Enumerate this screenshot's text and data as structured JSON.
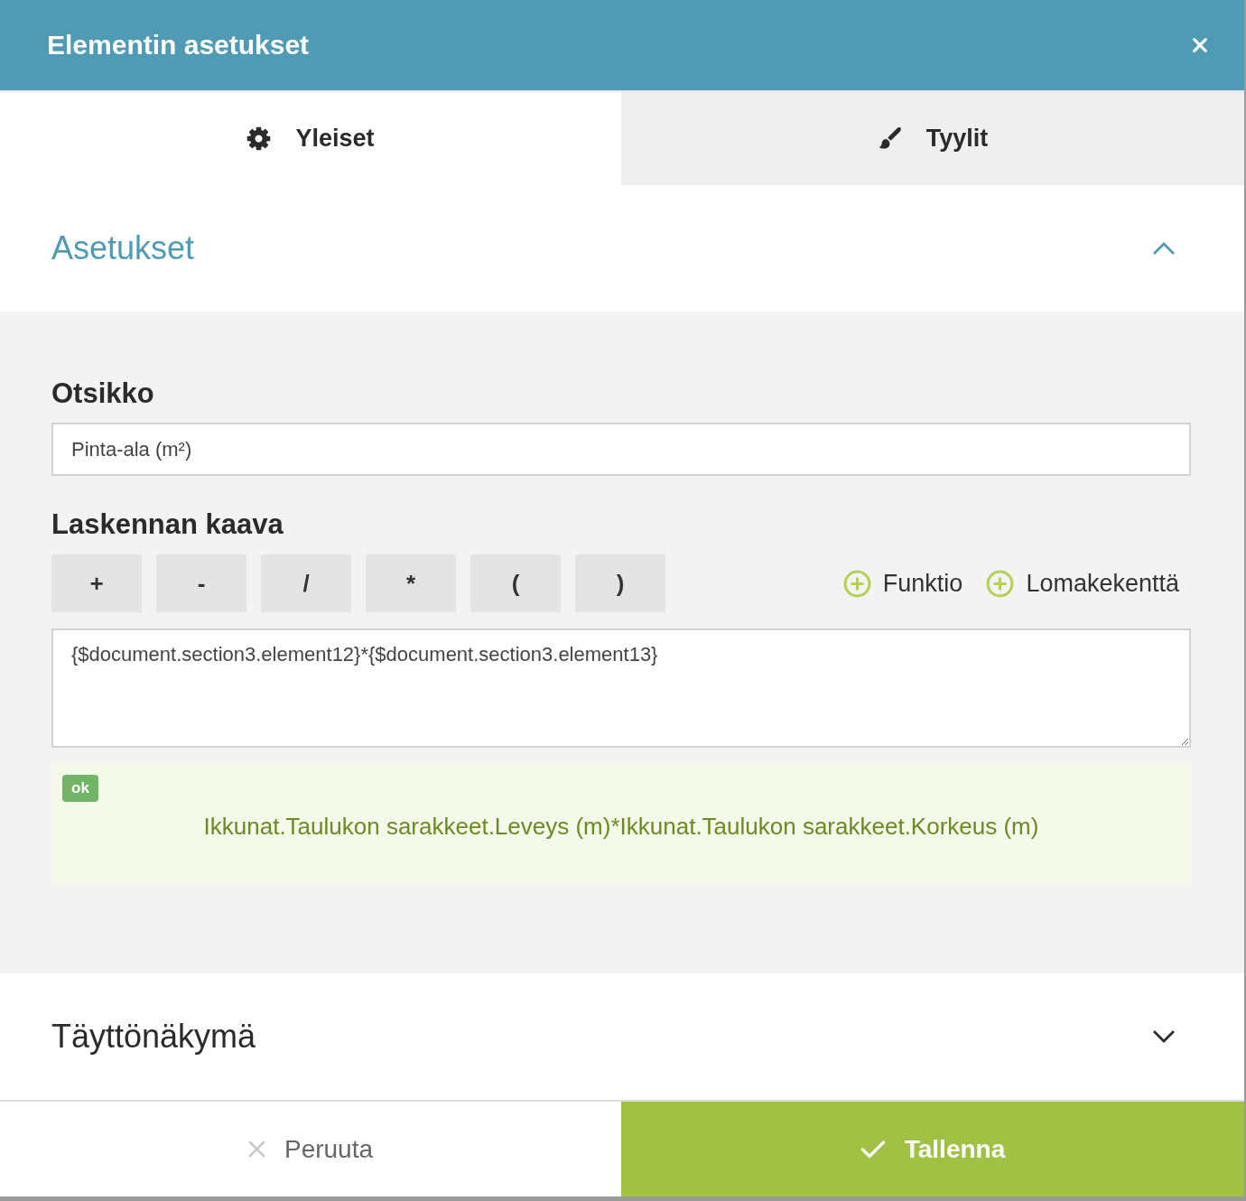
{
  "dialog": {
    "title": "Elementin asetukset"
  },
  "tabs": [
    {
      "label": "Yleiset",
      "kind": "general",
      "selected": true
    },
    {
      "label": "Tyylit",
      "kind": "styles",
      "selected": false
    }
  ],
  "sections": [
    {
      "title": "Asetukset",
      "expanded": true,
      "fields": [
        {
          "kind": "text",
          "label": "Otsikko",
          "value": "Pinta-ala (m²)"
        },
        {
          "kind": "formula",
          "label": "Laskennan kaava",
          "operators": [
            "+",
            "-",
            "/",
            "*",
            "(",
            ")"
          ],
          "links": [
            "Funktio",
            "Lomakekenttä"
          ],
          "value": "{$document.section3.element12}*{$document.section3.element13}",
          "result": {
            "badge": "ok",
            "valid": true,
            "text": "Ikkunat.Taulukon sarakkeet.Leveys (m)*Ikkunat.Taulukon sarakkeet.Korkeus (m)"
          }
        }
      ]
    },
    {
      "title": "Täyttönäkymä",
      "expanded": false
    }
  ],
  "actions": [
    {
      "label": "Peruuta",
      "kind": "cancel"
    },
    {
      "label": "Tallenna",
      "kind": "save"
    }
  ]
}
